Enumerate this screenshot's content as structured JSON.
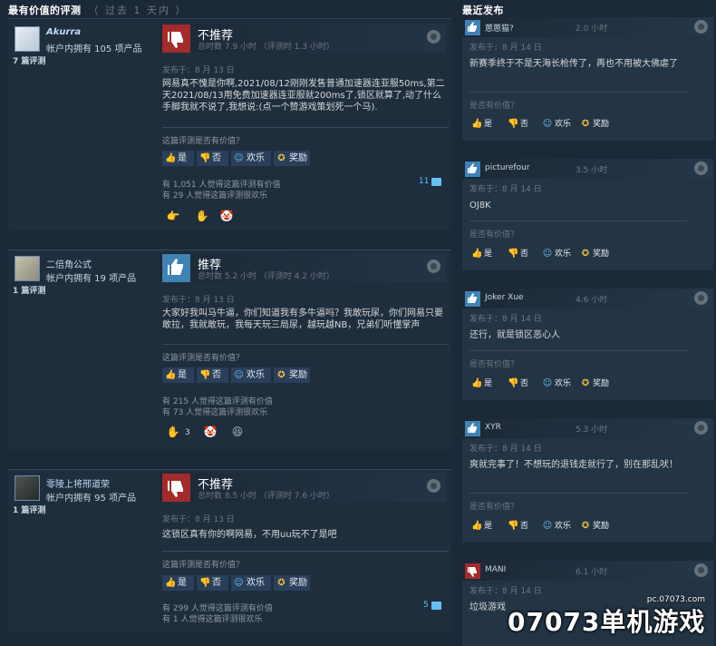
{
  "left_header": {
    "title": "最有价值的评测",
    "subtitle": "（ 过去 1 天内 ）"
  },
  "right_header": {
    "title": "最近发布"
  },
  "vote_buttons": {
    "yes": "是",
    "no": "否",
    "funny": "欢乐",
    "award": "奖励"
  },
  "helpful_question": "这篇评测是否有价值？",
  "reviews": [
    {
      "author": "Akurra",
      "products": "帐户内拥有 105 项产品",
      "review_count": "7 篇评测",
      "verdict": "不推荐",
      "hours": "总时数 7.9 小时 （评测时 1.3 小时）",
      "posted": "发布于：8 月 13 日",
      "content": "网易真不愧是你啊,2021/08/12刚刚发售普通加速器连亚服50ms,第二天2021/08/13用免费加速器连亚服就200ms了,锁区就算了,动了什么手脚我就不说了,我想说:(点一个赞游戏策划死一个马).",
      "helpful_stat": "有 1,051 人觉得这篇评测有价值",
      "funny_stat": "有 29 人觉得这篇评测很欢乐",
      "comments": "11",
      "awards": [
        {
          "icon": "fist-icon",
          "glyph": "👉",
          "count": ""
        },
        {
          "icon": "mittens-icon",
          "glyph": "✋",
          "count": ""
        },
        {
          "icon": "clown-icon",
          "glyph": "🤡",
          "count": ""
        }
      ]
    },
    {
      "author": "二倍角公式",
      "products": "帐户内拥有 19 项产品",
      "review_count": "1 篇评测",
      "verdict": "推荐",
      "hours": "总时数 5.2 小时 （评测时 4.2 小时）",
      "posted": "发布于：8 月 13 日",
      "content": "大家好我叫马牛逼，你们知道我有多牛逼吗？我敢玩尿，你们网易只要敢拉，我就敢玩，我每天玩三局尿，越玩越NB，兄弟们听懂掌声",
      "helpful_stat": "有 215 人觉得这篇评测有价值",
      "funny_stat": "有 73 人觉得这篇评测很欢乐",
      "comments": "",
      "awards": [
        {
          "icon": "mittens-icon",
          "glyph": "✋",
          "count": "3"
        },
        {
          "icon": "clown-icon",
          "glyph": "🤡",
          "count": ""
        },
        {
          "icon": "laughing-face-icon",
          "glyph": "😆",
          "count": ""
        }
      ]
    },
    {
      "author": "零陵上将邢道荣",
      "products": "帐户内拥有 95 项产品",
      "review_count": "1 篇评测",
      "verdict": "不推荐",
      "hours": "总时数 8.5 小时 （评测时 7.6 小时）",
      "posted": "发布于：8 月 13 日",
      "content": "这锁区真有你的啊网易，不用uu玩不了是吧",
      "helpful_stat": "有 299 人觉得这篇评测有价值",
      "funny_stat": "有 1 人觉得这篇评测很欢乐",
      "comments": "5",
      "awards": []
    }
  ],
  "recent_helpful_question": "是否有价值？",
  "recent": [
    {
      "author": "蒽蒽猫?",
      "hours": "2.0 小时",
      "verdict": "up",
      "posted": "发布于：8 月 14 日",
      "content": "新赛季终于不是天海长枪传了，再也不用被大佛虐了"
    },
    {
      "author": "picturefour",
      "hours": "3.5 小时",
      "verdict": "up",
      "posted": "发布于：8 月 14 日",
      "content": "OJ8K"
    },
    {
      "author": "Joker Xue",
      "hours": "4.6 小时",
      "verdict": "up",
      "posted": "发布于：8 月 14 日",
      "content": "还行，就是锁区恶心人"
    },
    {
      "author": "XYR",
      "hours": "5.3 小时",
      "verdict": "up",
      "posted": "发布于：8 月 14 日",
      "content": "爽就完事了！不想玩的退钱走就行了，别在那乱吠！"
    },
    {
      "author": "MANI",
      "hours": "6.1 小时",
      "verdict": "down",
      "posted": "发布于：8 月 14 日",
      "content": "垃圾游戏"
    }
  ],
  "watermark": {
    "url": "pc.07073.com",
    "logo": "07073单机游戏"
  }
}
